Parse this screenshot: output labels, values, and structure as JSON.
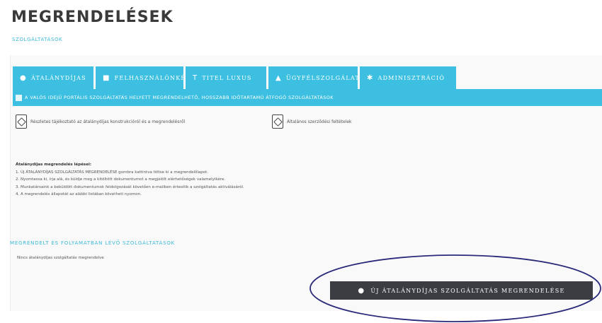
{
  "header": {
    "title": "MEGRENDELÉSEK",
    "subtitle": "SZOLGÁLTATÁSOK"
  },
  "tabs": [
    {
      "label": "ÁTALÁNYDÍJAS",
      "icon": "chat-bubble-icon"
    },
    {
      "label": "FELHASZNÁLÓNKÉNT",
      "icon": "user-icon"
    },
    {
      "label": "TITEL LUXUS",
      "icon": "tag-icon"
    },
    {
      "label": "ÜGYFÉLSZOLGÁLAT",
      "icon": "home-icon"
    },
    {
      "label": "ADMINISZTRÁCIÓ",
      "icon": "gear-icon"
    }
  ],
  "info_bar": {
    "text": "A VALÓS IDEJŰ PORTÁLIS SZOLGÁLTATÁS HELYETT MEGRENDELHETŐ, HOSSZABB IDŐTARTAMÚ ÁTFOGÓ SZOLGÁLTATÁSOK"
  },
  "documents": [
    {
      "label": "Részletes tájékoztató az átalánydíjas konstrukcióról és a megrendelésről",
      "icon": "pdf-icon"
    },
    {
      "label": "Általános szerződési feltételek",
      "icon": "pdf-icon"
    }
  ],
  "steps": {
    "title": "Átalánydíjas megrendelés lépései:",
    "items": [
      "1. Új ÁTALÁNYDÍJAS SZOLGÁLTATÁS MEGRENDELÉSE gombra kattintva töltse ki a megrendelőlapot.",
      "2. Nyomtassa ki, írja alá, és küldje meg a kitöltött dokumentumot a megjelölt elérhetőségek valamelyikére.",
      "3. Munkatársaink a beküldött dokumentumok feldolgozását követően e-mailben értesítik a szolgáltatás aktiválásáról.",
      "4. A megrendelés állapotát az alábbi listában követheti nyomon."
    ]
  },
  "orders_section": {
    "heading": "MEGRENDELT ÉS FOLYAMATBAN LÉVŐ SZOLGÁLTATÁSOK",
    "empty_note": "Nincs átalánydíjas szolgáltatás megrendelve"
  },
  "new_order_button": {
    "label": "ÚJ ÁTALÁNYDÍJAS SZOLGÁLTATÁS MEGRENDELÉSE",
    "icon": "chat-bubble-icon"
  },
  "colors": {
    "accent": "#3cbfe0",
    "button_dark": "#3b3d42",
    "annotation": "#2a2a7a"
  }
}
